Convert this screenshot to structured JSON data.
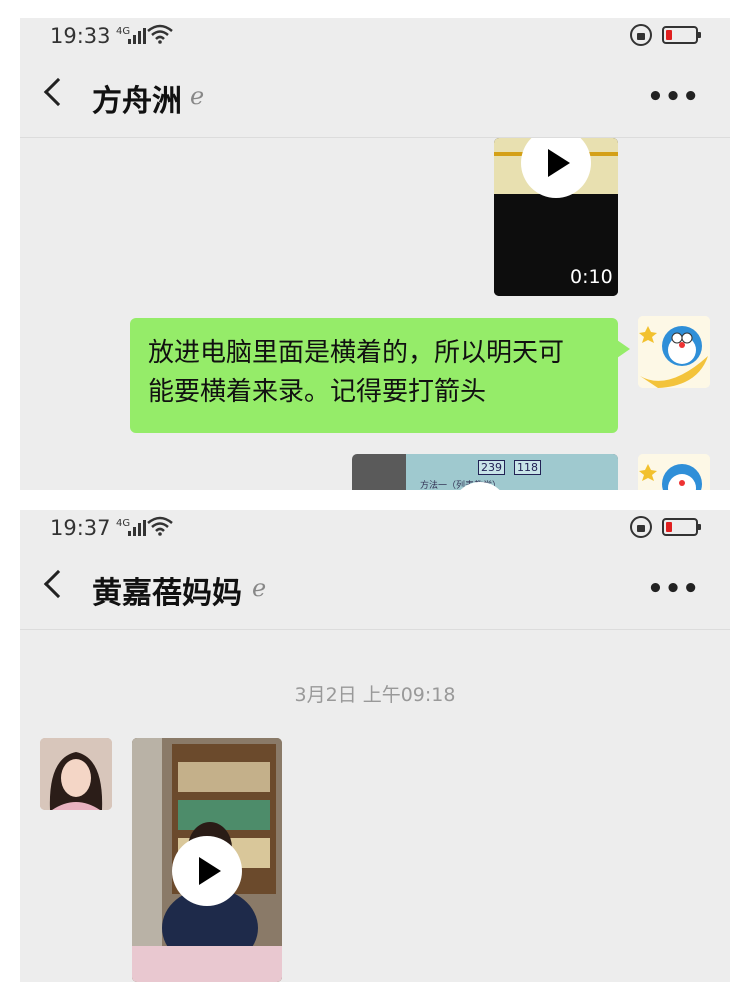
{
  "screenshots": [
    {
      "status_bar": {
        "time": "19:33",
        "network": "4G"
      },
      "header": {
        "title": "方舟洲"
      },
      "messages": [
        {
          "type": "video",
          "direction": "outgoing",
          "duration": "0:10"
        },
        {
          "type": "text",
          "direction": "outgoing",
          "text_lines": [
            "放进电脑里面是横着的，所以明天可",
            "能要横着来录。记得要打箭头"
          ]
        },
        {
          "type": "video",
          "direction": "outgoing",
          "preview_text": [
            "239",
            "118",
            "方法一（列表教学）"
          ]
        }
      ]
    },
    {
      "status_bar": {
        "time": "19:37",
        "network": "4G"
      },
      "header": {
        "title": "黄嘉蓓妈妈"
      },
      "timestamp": "3月2日 上午09:18",
      "messages": [
        {
          "type": "video",
          "direction": "incoming"
        }
      ]
    }
  ],
  "icons": {
    "back": "chevron-left-icon",
    "ear": "ear-icon",
    "more": "more-dots-icon",
    "play": "play-icon"
  },
  "colors": {
    "chat_background": "#ededed",
    "outgoing_bubble": "#95ec69",
    "battery_low": "#e02020",
    "timestamp_text": "#999999"
  }
}
